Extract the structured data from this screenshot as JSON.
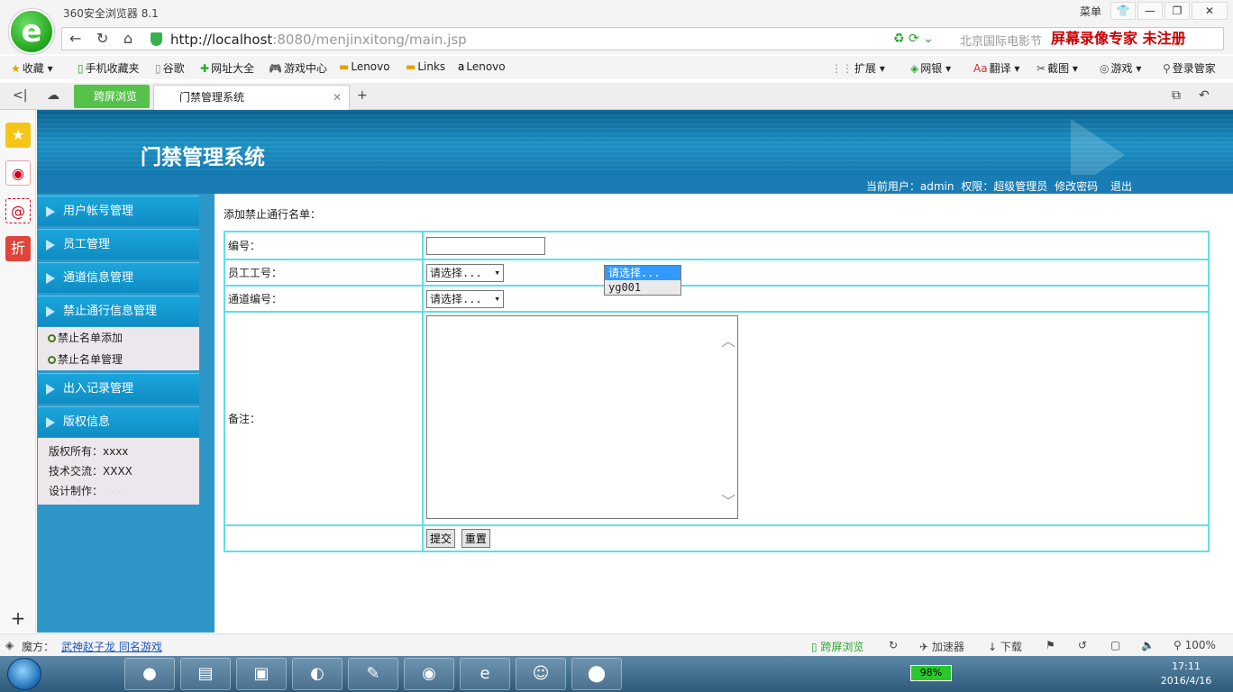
{
  "browser": {
    "app_title": "360安全浏览器 8.1",
    "menu_label": "菜单",
    "url_host": "http://localhost",
    "url_rest": ":8080/menjinxitong/main.jsp",
    "search_text": "北京国际电影节",
    "watermark": "屏幕录像专家  未注册",
    "bookmarks": [
      "收藏",
      "手机收藏夹",
      "谷歌",
      "网址大全",
      "游戏中心",
      "Lenovo",
      "Links",
      "Lenovo"
    ],
    "toolbar_right": [
      "扩展",
      "网银",
      "翻译",
      "截图",
      "游戏",
      "登录管家"
    ],
    "tab_green": "跨屏浏览",
    "tab_active": "门禁管理系统"
  },
  "header": {
    "title": "门禁管理系统",
    "current_user_label": "当前用户：",
    "current_user": "admin",
    "role_label": "权限：",
    "role": "超级管理员",
    "change_password": "修改密码",
    "logout": "退出"
  },
  "menu": {
    "items": [
      "用户帐号管理",
      "员工管理",
      "通道信息管理",
      "禁止通行信息管理",
      "出入记录管理",
      "版权信息"
    ],
    "sub_items": [
      "禁止名单添加",
      "禁止名单管理"
    ],
    "copyright": [
      "版权所有：xxxx",
      "技术交流：XXXX",
      "设计制作："
    ],
    "copyright_faint": "xxx"
  },
  "form": {
    "title": "添加禁止通行名单：",
    "id_label": "编号：",
    "id_value": "",
    "emp_label": "员工工号：",
    "channel_label": "通道编号：",
    "channel_value": "请选择...",
    "memo_label": "备注：",
    "submit": "提交",
    "reset": "重置",
    "emp_options": [
      "请选择...",
      "yg001"
    ],
    "emp_selected": "请选择..."
  },
  "statusbar": {
    "magic_label": "魔方：",
    "magic_link": "武神赵子龙 同名游戏",
    "items": [
      "跨屏浏览",
      "加速器",
      "下载"
    ],
    "zoom": "100%"
  },
  "taskbar": {
    "battery": "98%",
    "time": "17:11",
    "date": "2016/4/16"
  }
}
